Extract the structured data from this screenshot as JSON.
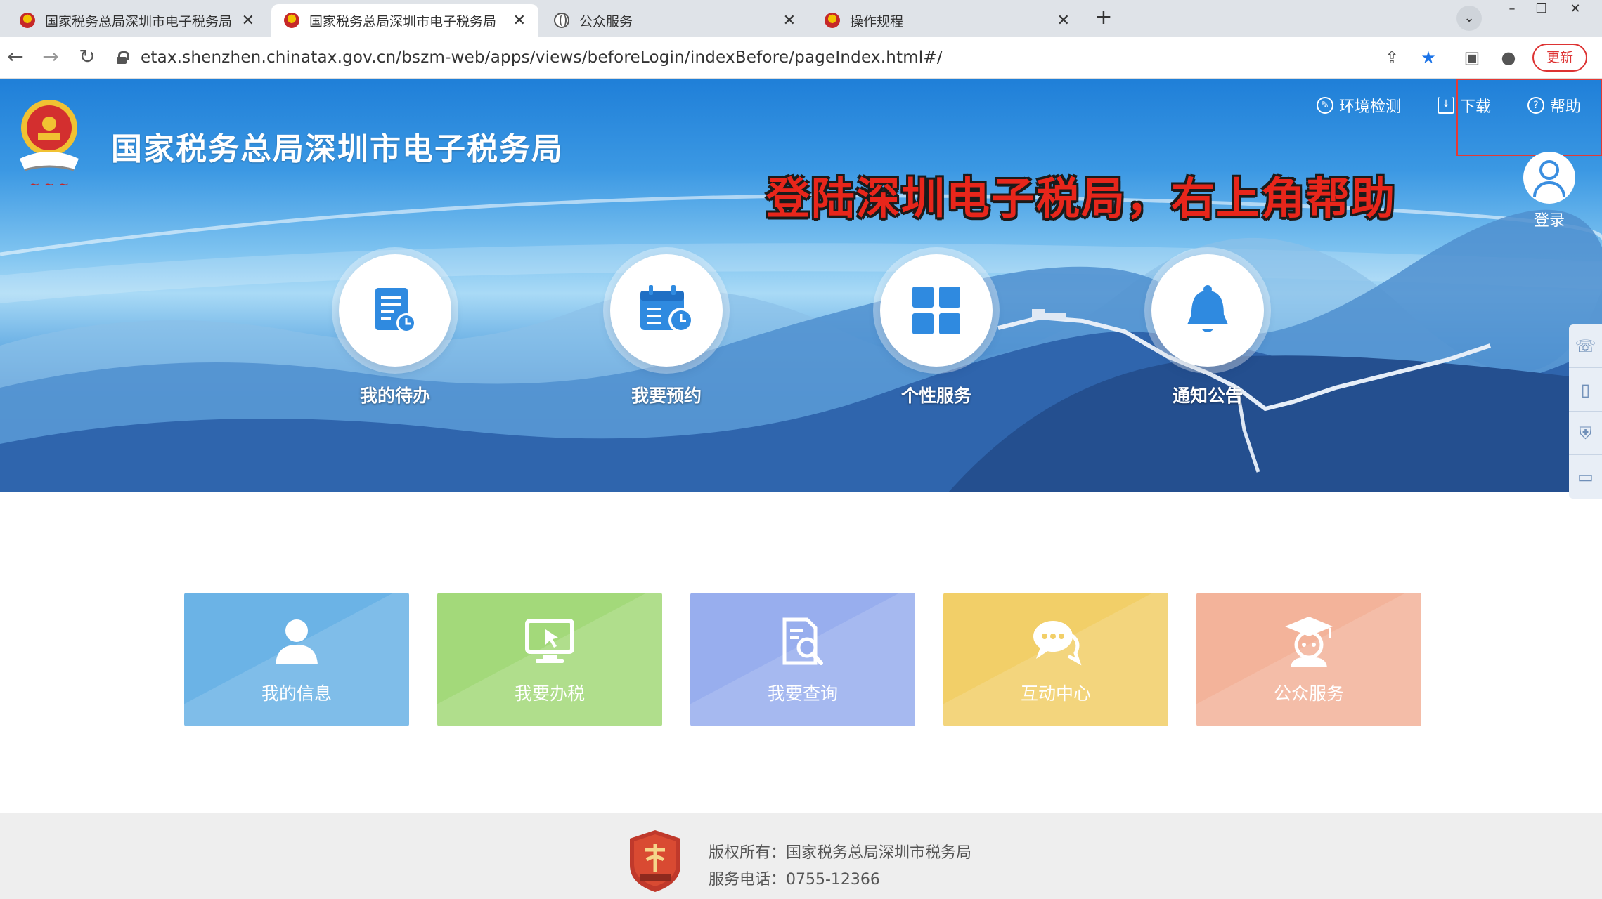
{
  "browser": {
    "tabs": [
      {
        "label": "国家税务总局深圳市电子税务局",
        "icon": "tax-emblem-icon",
        "active": false
      },
      {
        "label": "国家税务总局深圳市电子税务局",
        "icon": "tax-emblem-icon",
        "active": true
      },
      {
        "label": "公众服务",
        "icon": "globe-icon",
        "active": false
      },
      {
        "label": "操作规程",
        "icon": "tax-emblem-icon",
        "active": false
      }
    ],
    "close_glyph": "✕",
    "url": "etax.shenzhen.chinatax.gov.cn/bszm-web/apps/views/beforeLogin/indexBefore/pageIndex.html#/",
    "update_label": "更新"
  },
  "header": {
    "title": "国家税务总局深圳市电子税务局",
    "links": [
      {
        "label": "环境检测",
        "icon": "tool-icon"
      },
      {
        "label": "下载",
        "icon": "download-icon"
      },
      {
        "label": "帮助",
        "icon": "help-icon"
      }
    ],
    "login_label": "登录",
    "annotation": "登陆深圳电子税局，右上角帮助"
  },
  "hero_items": [
    {
      "label": "我的待办",
      "icon": "todo-document-icon"
    },
    {
      "label": "我要预约",
      "icon": "calendar-clock-icon"
    },
    {
      "label": "个性服务",
      "icon": "grid-icon"
    },
    {
      "label": "通知公告",
      "icon": "bell-icon"
    }
  ],
  "tiles": [
    {
      "label": "我的信息",
      "icon": "user-icon",
      "color": "#6bb3e6"
    },
    {
      "label": "我要办税",
      "icon": "monitor-icon",
      "color": "#a3d97a"
    },
    {
      "label": "我要查询",
      "icon": "search-document-icon",
      "color": "#98aeee"
    },
    {
      "label": "互动中心",
      "icon": "chat-icon",
      "color": "#f2cf68"
    },
    {
      "label": "公众服务",
      "icon": "graduate-icon",
      "color": "#f3b39a"
    }
  ],
  "footer": {
    "copyright": "版权所有：国家税务总局深圳市税务局",
    "phone": "服务电话：0755-12366"
  },
  "colors": {
    "accent_blue": "#2a86dc",
    "annotation_red": "#e8261b",
    "highlight_red": "#e53935"
  }
}
